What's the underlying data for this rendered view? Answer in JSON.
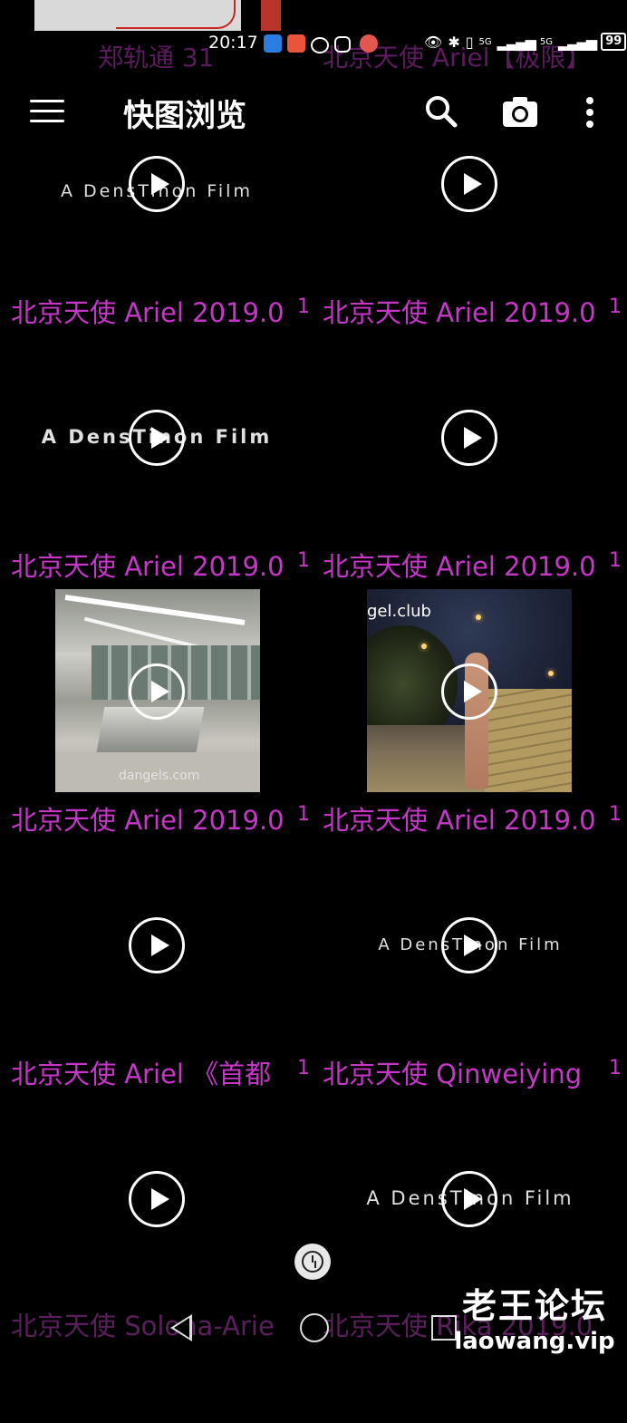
{
  "status_bar": {
    "time": "20:17",
    "peek_title_left": "郑轨通 31",
    "peek_title_right": "北京天使 Ariel【极限】",
    "network_left": "5G",
    "network_right": "5G",
    "battery": "99"
  },
  "app_bar": {
    "title": "快图浏览"
  },
  "grid": {
    "items": [
      {
        "caption": "北京天使 Ariel 2019.0",
        "count": "1",
        "thumb_text": "A DensTinon Film"
      },
      {
        "caption": "北京天使 Ariel 2019.0",
        "count": "1",
        "thumb_text": ""
      },
      {
        "caption": "北京天使 Ariel 2019.0",
        "count": "1",
        "thumb_text": "A DensTinon Film"
      },
      {
        "caption": "北京天使 Ariel 2019.0",
        "count": "1",
        "thumb_text": ""
      },
      {
        "caption": "北京天使 Ariel 2019.0",
        "count": "1",
        "thumb_text": "dangels.com"
      },
      {
        "caption": "北京天使 Ariel 2019.0",
        "count": "1",
        "thumb_text": "gel.club"
      },
      {
        "caption": "北京天使 Ariel 《首都",
        "count": "1",
        "thumb_text": ""
      },
      {
        "caption": "北京天使 Qinweiying",
        "count": "1",
        "thumb_text": "A DensTinon Film"
      },
      {
        "caption": "",
        "count": "",
        "thumb_text": ""
      },
      {
        "caption": "",
        "count": "",
        "thumb_text": "A DensTinon Film"
      }
    ],
    "bottom_peek_left": "北京天使 Solona-Arie",
    "bottom_peek_right": "北京天使 Rika 2019.0"
  },
  "watermark": {
    "forum_name": "老王论坛",
    "forum_url": "laowang.vip"
  }
}
